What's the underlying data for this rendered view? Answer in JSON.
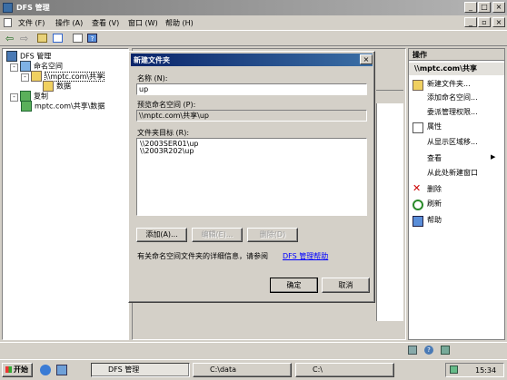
{
  "window": {
    "title": "DFS 管理"
  },
  "menu": [
    "文件 (F)",
    "操作 (A)",
    "查看 (V)",
    "窗口 (W)",
    "帮助 (H)"
  ],
  "tree": {
    "root": "DFS 管理",
    "namespace": "命名空间",
    "share": "\\\\mptc.com\\共享",
    "data": "数据",
    "replication": "复制",
    "replication_item": "mptc.com\\共享\\数据"
  },
  "actions": {
    "header": "操作",
    "group": "\\\\mptc.com\\共享",
    "items": [
      "新建文件夹...",
      "添加命名空间...",
      "委派管理权限...",
      "属性",
      "从显示区域移...",
      "查看",
      "从此处新建窗口",
      "删除",
      "刷新",
      "帮助"
    ]
  },
  "dialog": {
    "title": "新建文件夹",
    "name_label": "名称 (N):",
    "name_value": "up",
    "preview_label": "预览命名空间 (P):",
    "preview_value": "\\\\mptc.com\\共享\\up",
    "targets_label": "文件夹目标 (R):",
    "targets": [
      "\\\\2003SER01\\up",
      "\\\\2003R202\\up"
    ],
    "add_button": "添加(A)...",
    "edit_button": "编辑(E)...",
    "delete_button": "删除(D)",
    "info_text": "有关命名空间文件夹的详细信息，请参阅",
    "info_link": "DFS 管理帮助",
    "ok_button": "确定",
    "cancel_button": "取消"
  },
  "taskbar": {
    "start": "开始",
    "tasks": [
      "DFS 管理",
      "C:\\data",
      "C:\\"
    ],
    "clock": "15:34"
  }
}
